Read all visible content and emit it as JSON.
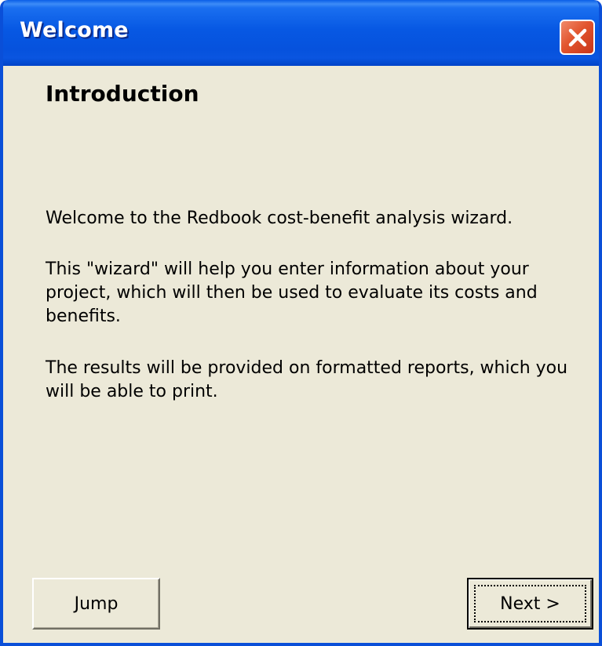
{
  "window": {
    "title": "Welcome",
    "close_icon": "close-x-icon",
    "colors": {
      "titlebar": "#0758e3",
      "window_bg": "#ece9d8",
      "close_button": "#e2552e"
    }
  },
  "content": {
    "heading": "Introduction",
    "paragraphs": [
      "Welcome to the Redbook cost-benefit analysis wizard.",
      "This \"wizard\" will help you enter information about your project, which will then be used to evaluate its costs and benefits.",
      "The results will be provided on formatted reports, which you will be able to print."
    ]
  },
  "buttons": {
    "jump_label": "Jump",
    "next_label": "Next >"
  }
}
